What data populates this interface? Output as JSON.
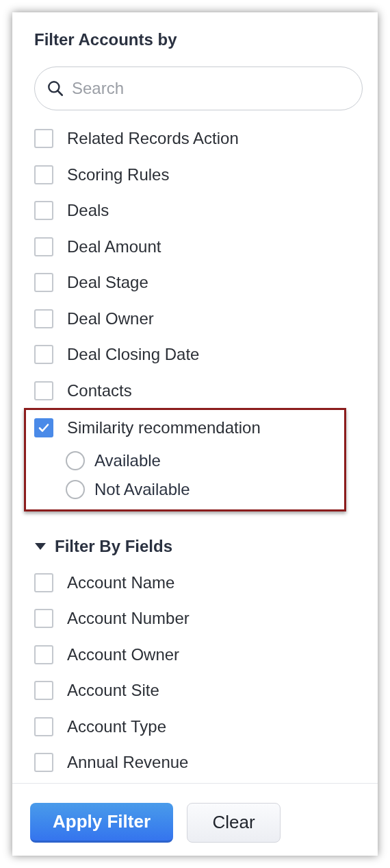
{
  "title": "Filter Accounts by",
  "search": {
    "placeholder": "Search"
  },
  "filters": [
    {
      "label": "Related Records Action",
      "checked": false
    },
    {
      "label": "Scoring Rules",
      "checked": false
    },
    {
      "label": "Deals",
      "checked": false
    },
    {
      "label": "Deal Amount",
      "checked": false
    },
    {
      "label": "Deal Stage",
      "checked": false
    },
    {
      "label": "Deal Owner",
      "checked": false
    },
    {
      "label": "Deal Closing Date",
      "checked": false
    },
    {
      "label": "Contacts",
      "checked": false
    },
    {
      "label": "Similarity recommendation",
      "checked": true,
      "highlighted": true,
      "options": [
        {
          "label": "Available",
          "selected": false
        },
        {
          "label": "Not Available",
          "selected": false
        }
      ]
    }
  ],
  "section": {
    "title": "Filter By Fields",
    "expanded": true,
    "fields": [
      {
        "label": "Account Name",
        "checked": false
      },
      {
        "label": "Account Number",
        "checked": false
      },
      {
        "label": "Account Owner",
        "checked": false
      },
      {
        "label": "Account Site",
        "checked": false
      },
      {
        "label": "Account Type",
        "checked": false
      },
      {
        "label": "Annual Revenue",
        "checked": false
      }
    ]
  },
  "buttons": [
    {
      "label": "Apply Filter",
      "kind": "primary"
    },
    {
      "label": "Clear",
      "kind": "secondary"
    }
  ]
}
